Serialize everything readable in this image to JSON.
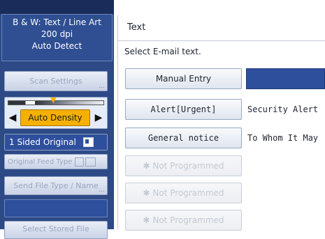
{
  "left_panel": {
    "scan_mode": "B & W: Text / Line Art",
    "resolution": "200 dpi",
    "detect": "Auto Detect",
    "scan_settings": "Scan Settings",
    "density_label": "Auto Density",
    "sided": "1 Sided Original",
    "feed_type": "Original Feed Type",
    "send_file_type": "Send File Type / Name",
    "select_file": "Select Stored File",
    "more_dots": "...",
    "prev_arrow": "◀",
    "next_arrow": "▶",
    "indicator_arrow": "▼"
  },
  "text_panel": {
    "title": "Text",
    "instruction": "Select E-mail text.",
    "manual_entry": "Manual Entry",
    "items": [
      {
        "label": "Alert[Urgent]",
        "preview": "Security Alert"
      },
      {
        "label": "General notice",
        "preview": "To Whom It May"
      },
      {
        "label": "✱ Not Programmed",
        "preview": ""
      },
      {
        "label": "✱ Not Programmed",
        "preview": ""
      },
      {
        "label": "✱ Not Programmed",
        "preview": ""
      }
    ]
  },
  "colors": {
    "panel_blue": "#2d4a86",
    "highlight_orange": "#f5b000",
    "selected_blue": "#2e4f9c"
  }
}
